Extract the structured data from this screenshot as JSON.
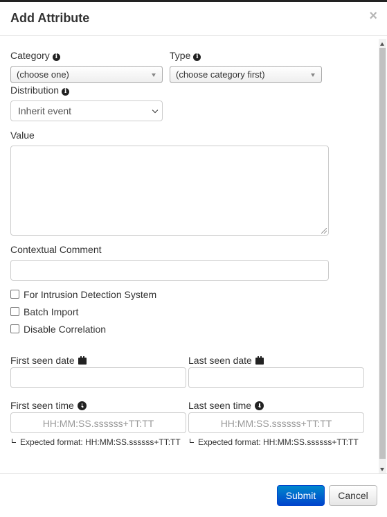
{
  "header": {
    "title": "Add Attribute",
    "close_symbol": "×"
  },
  "form": {
    "category": {
      "label": "Category",
      "value": "(choose one)"
    },
    "type": {
      "label": "Type",
      "value": "(choose category first)"
    },
    "distribution": {
      "label": "Distribution",
      "value": "Inherit event"
    },
    "value": {
      "label": "Value",
      "text": ""
    },
    "comment": {
      "label": "Contextual Comment",
      "text": ""
    },
    "checkboxes": [
      {
        "label": "For Intrusion Detection System",
        "checked": false
      },
      {
        "label": "Batch Import",
        "checked": false
      },
      {
        "label": "Disable Correlation",
        "checked": false
      }
    ],
    "first_seen_date": {
      "label": "First seen date",
      "value": ""
    },
    "last_seen_date": {
      "label": "Last seen date",
      "value": ""
    },
    "first_seen_time": {
      "label": "First seen time",
      "placeholder": "HH:MM:SS.ssssss+TT:TT",
      "hint": "Expected format: HH:MM:SS.ssssss+TT:TT"
    },
    "last_seen_time": {
      "label": "Last seen time",
      "placeholder": "HH:MM:SS.ssssss+TT:TT",
      "hint": "Expected format: HH:MM:SS.ssssss+TT:TT"
    }
  },
  "footer": {
    "submit_label": "Submit",
    "cancel_label": "Cancel"
  },
  "icons": {
    "info": "info-icon",
    "calendar": "calendar-icon",
    "clock": "clock-icon"
  },
  "colors": {
    "primary": "#0055cc",
    "header_border": "#222222"
  }
}
